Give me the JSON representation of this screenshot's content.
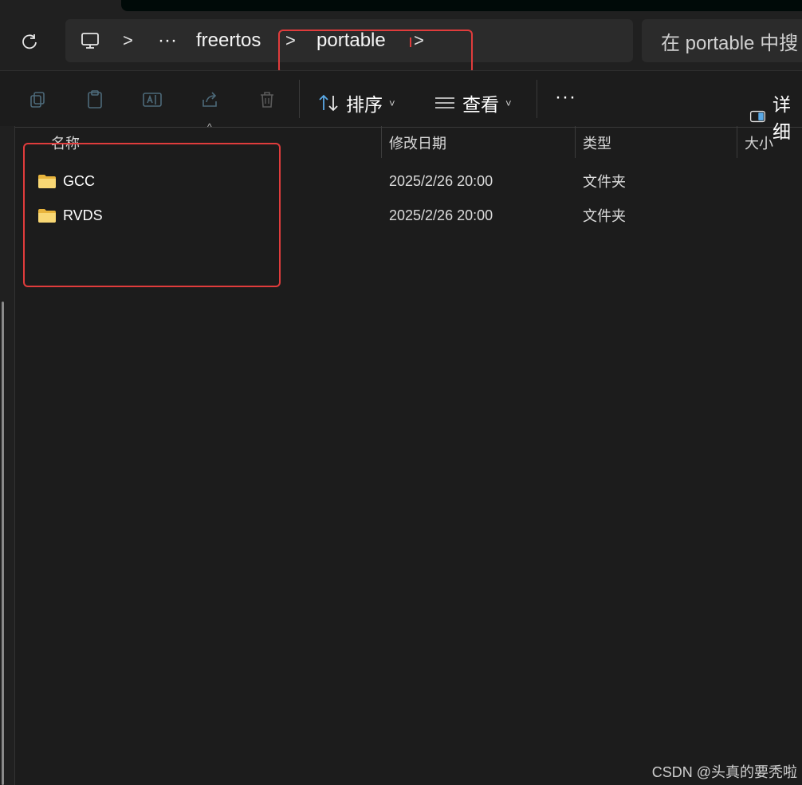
{
  "address": {
    "ellipsis": "···",
    "crumbs": [
      "freertos",
      "portable"
    ],
    "sep": ">"
  },
  "search": {
    "placeholder": "在 portable 中搜"
  },
  "toolbar": {
    "sort_label": "排序",
    "view_label": "查看",
    "more_label": "···",
    "details_label": "详细",
    "caret": "˅"
  },
  "columns": {
    "name": "名称",
    "date": "修改日期",
    "type": "类型",
    "size": "大小"
  },
  "files": [
    {
      "name": "GCC",
      "date": "2025/2/26 20:00",
      "type": "文件夹"
    },
    {
      "name": "RVDS",
      "date": "2025/2/26 20:00",
      "type": "文件夹"
    }
  ],
  "watermark": "CSDN @头真的要秃啦",
  "colors": {
    "annotation": "#e03c3c",
    "folder": "#f4c64e"
  }
}
